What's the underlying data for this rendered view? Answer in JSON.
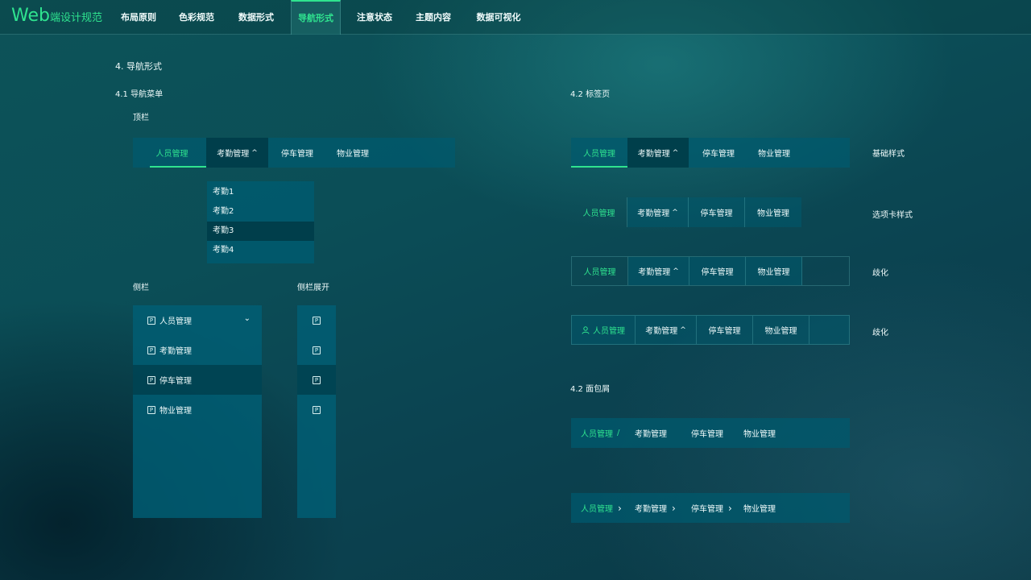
{
  "app": {
    "logo_big": "Web",
    "logo_small": "端设计规范"
  },
  "topnav": [
    {
      "label": "布局原则"
    },
    {
      "label": "色彩规范"
    },
    {
      "label": "数据形式"
    },
    {
      "label": "导航形式"
    },
    {
      "label": "注意状态"
    },
    {
      "label": "主题内容"
    },
    {
      "label": "数据可视化"
    }
  ],
  "colors": {
    "accent": "#2fe38f",
    "panel": "#005a6e",
    "hover": "#003c48"
  },
  "section": {
    "title": "4. 导航形式",
    "nav_menu": "4.1  导航菜单",
    "tabs": "4.2  标签页",
    "breadcrumb": "4.2  面包屑",
    "topbar_label": "顶栏",
    "sidebar_label": "侧栏",
    "sidebar_expanded_label": "侧栏展开"
  },
  "menu": {
    "items": [
      "人员管理",
      "考勤管理",
      "停车管理",
      "物业管理"
    ],
    "dropdown": [
      "考勤1",
      "考勤2",
      "考勤3",
      "考勤4"
    ]
  },
  "tab_styles": [
    "基础样式",
    "选项卡样式",
    "歧化",
    "歧化"
  ],
  "icons": {
    "chevron_up": "^",
    "chevron_down": "⌄",
    "slash": "/",
    "chevron_right": "›",
    "p_icon": "P"
  }
}
